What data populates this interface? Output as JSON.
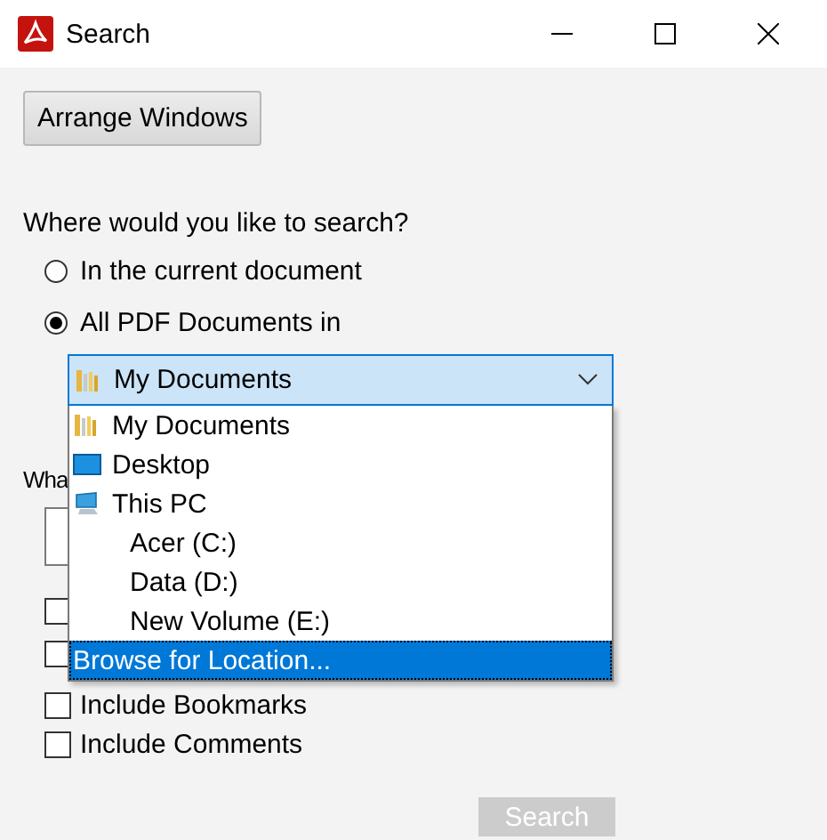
{
  "window": {
    "title": "Search"
  },
  "arrange_button": {
    "label": "Arrange Windows"
  },
  "scope": {
    "question": "Where would you like to search?",
    "options": [
      {
        "label": "In the current document",
        "selected": false
      },
      {
        "label": "All PDF Documents in",
        "selected": true
      }
    ]
  },
  "location": {
    "value": "My Documents",
    "kind": "folder"
  },
  "location_list": {
    "items": [
      {
        "label": "My Documents",
        "kind": "folder",
        "selected": false
      },
      {
        "label": "Desktop",
        "kind": "desktop",
        "selected": false
      },
      {
        "label": "This PC",
        "kind": "pc",
        "selected": false,
        "children": [
          {
            "label": "Acer (C:)",
            "kind": "drive",
            "selected": false
          },
          {
            "label": "Data (D:)",
            "kind": "drive",
            "selected": false
          },
          {
            "label": "New Volume (E:)",
            "kind": "drive",
            "selected": false
          }
        ]
      },
      {
        "label": "Browse for Location...",
        "kind": "browse",
        "selected": true
      }
    ]
  },
  "search_for_label": "Wha",
  "options": [
    {
      "checked": false
    },
    {
      "checked": false
    },
    {
      "label": "Include Bookmarks",
      "checked": false
    },
    {
      "label": "Include Comments",
      "checked": false
    }
  ],
  "search_button": {
    "label": "Search",
    "disabled": true
  }
}
